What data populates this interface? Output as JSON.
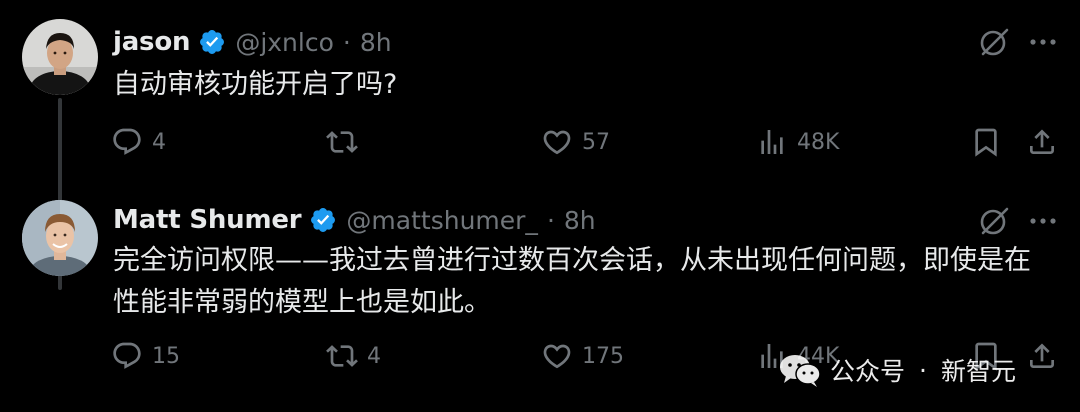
{
  "tweets": [
    {
      "author": {
        "name": "jason",
        "handle": "@jxnlco",
        "verified": true
      },
      "time": "8h",
      "separator": "·",
      "text": "自动审核功能开启了吗?",
      "actions": {
        "replies": "4",
        "reposts": "",
        "likes": "57",
        "views": "48K"
      }
    },
    {
      "author": {
        "name": "Matt Shumer",
        "handle": "@mattshumer_",
        "verified": true
      },
      "time": "8h",
      "separator": "·",
      "text_lines": [
        "完全访问权限——我过去曾进行过数百次会话，从未出现任何问题，即使是在",
        "性能非常弱的模型上也是如此。"
      ],
      "actions": {
        "replies": "15",
        "reposts": "4",
        "likes": "175",
        "views": "44K"
      }
    }
  ],
  "watermark": {
    "source": "公众号",
    "dot": "·",
    "name": "新智元"
  },
  "colors": {
    "background": "#000000",
    "text_primary": "#e7e9ea",
    "text_secondary": "#71767b",
    "verified_badge": "#1d9bf0",
    "thread_line": "#333639"
  },
  "icons": [
    "reply-icon",
    "repost-icon",
    "like-icon",
    "views-icon",
    "bookmark-icon",
    "share-icon",
    "grok-icon",
    "more-icon",
    "verified-icon"
  ]
}
